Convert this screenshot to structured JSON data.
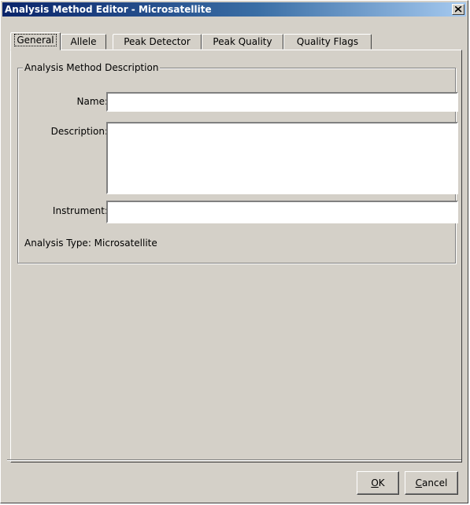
{
  "window": {
    "title": "Analysis Method Editor - Microsatellite"
  },
  "tabs": [
    {
      "label": "General"
    },
    {
      "label": "Allele"
    },
    {
      "label": "Peak Detector"
    },
    {
      "label": "Peak Quality"
    },
    {
      "label": "Quality Flags"
    }
  ],
  "general": {
    "group_title": "Analysis Method Description",
    "name_label": "Name:",
    "name_value": "",
    "description_label": "Description:",
    "description_value": "",
    "instrument_label": "Instrument:",
    "instrument_value": "",
    "analysis_type_text": "Analysis Type: Microsatellite"
  },
  "buttons": {
    "ok_mnemonic": "O",
    "ok_rest": "K",
    "cancel_mnemonic": "C",
    "cancel_rest": "ancel"
  }
}
